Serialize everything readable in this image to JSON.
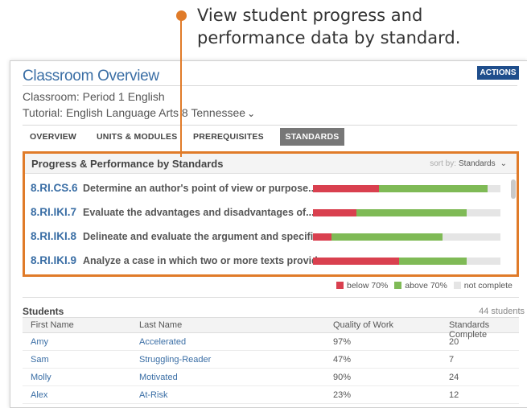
{
  "callout": {
    "line1": "View student progress and",
    "line2": "performance data by standard."
  },
  "header": {
    "title": "Classroom Overview",
    "actions_label": "ACTIONS",
    "classroom": "Classroom: Period 1 English",
    "tutorial": "Tutorial: English Language Arts 8 Tennessee"
  },
  "tabs": [
    {
      "label": "OVERVIEW"
    },
    {
      "label": "UNITS & MODULES"
    },
    {
      "label": "PREREQUISITES"
    },
    {
      "label": "STANDARDS",
      "active": true
    }
  ],
  "standards": {
    "title": "Progress & Performance by Standards",
    "sort_label": "sort by:",
    "sort_value": "Standards",
    "rows": [
      {
        "code": "8.RI.CS.6",
        "description": "Determine an author's point of view or purpose...",
        "below_pct": 35,
        "above_pct": 58
      },
      {
        "code": "8.RI.IKI.7",
        "description": "Evaluate the advantages and disadvantages of...",
        "below_pct": 23,
        "above_pct": 59
      },
      {
        "code": "8.RI.IKI.8",
        "description": "Delineate and evaluate the argument and specific...",
        "below_pct": 10,
        "above_pct": 59
      },
      {
        "code": "8.RI.IKI.9",
        "description": "Analyze a case in which two or more texts provide...",
        "below_pct": 46,
        "above_pct": 36
      }
    ]
  },
  "legend": {
    "below": "below 70%",
    "above": "above 70%",
    "not_complete": "not complete"
  },
  "colors": {
    "below": "#d9404f",
    "above": "#7fba56",
    "not_complete": "#e5e5e5",
    "accent": "#e07b29",
    "link": "#3a6ea5"
  },
  "students": {
    "label": "Students",
    "count": "44 students",
    "columns": [
      "First Name",
      "Last Name",
      "Quality of Work",
      "Standards Complete"
    ],
    "rows": [
      [
        "Amy",
        "Accelerated",
        "97%",
        "20"
      ],
      [
        "Sam",
        "Struggling-Reader",
        "47%",
        "7"
      ],
      [
        "Molly",
        "Motivated",
        "90%",
        "24"
      ],
      [
        "Alex",
        "At-Risk",
        "23%",
        "12"
      ]
    ]
  }
}
